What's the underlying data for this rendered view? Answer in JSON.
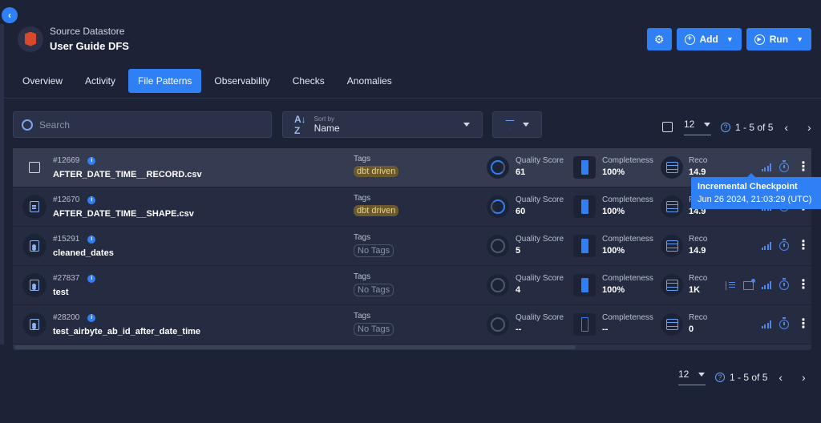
{
  "header": {
    "subtitle": "Source Datastore",
    "title": "User Guide DFS"
  },
  "actions": {
    "add_label": "Add",
    "run_label": "Run"
  },
  "tabs": [
    {
      "label": "Overview"
    },
    {
      "label": "Activity"
    },
    {
      "label": "File Patterns",
      "active": true
    },
    {
      "label": "Observability"
    },
    {
      "label": "Checks"
    },
    {
      "label": "Anomalies"
    }
  ],
  "search": {
    "placeholder": "Search"
  },
  "sort": {
    "label": "Sort by",
    "value": "Name"
  },
  "pager_top": {
    "per_page": "12",
    "range": "1 - 5 of 5"
  },
  "pager_bottom": {
    "per_page": "12",
    "range": "1 - 5 of 5"
  },
  "columns": {
    "tags": "Tags",
    "quality": "Quality Score",
    "completeness": "Completeness",
    "records": "Reco"
  },
  "rows": [
    {
      "id": "#12669",
      "name": "AFTER_DATE_TIME__RECORD.csv",
      "tag": "dbt driven",
      "quality": "61",
      "completeness": "100%",
      "records": "14.9"
    },
    {
      "id": "#12670",
      "name": "AFTER_DATE_TIME__SHAPE.csv",
      "tag": "dbt driven",
      "quality": "60",
      "completeness": "100%",
      "records": "14.9"
    },
    {
      "id": "#15291",
      "name": "cleaned_dates",
      "tag": "No Tags",
      "quality": "5",
      "completeness": "100%",
      "records": "14.9"
    },
    {
      "id": "#27837",
      "name": "test",
      "tag": "No Tags",
      "quality": "4",
      "completeness": "100%",
      "records": "1K"
    },
    {
      "id": "#28200",
      "name": "test_airbyte_ab_id_after_date_time",
      "tag": "No Tags",
      "quality": "--",
      "completeness": "--",
      "records": "0"
    }
  ],
  "tooltip": {
    "title": "Incremental Checkpoint",
    "time": "Jun 26 2024, 21:03:29 (UTC)"
  },
  "colors": {
    "accent": "#2f7ff5",
    "background": "#1c2337",
    "tag_dbt": "#6b5a2e"
  }
}
